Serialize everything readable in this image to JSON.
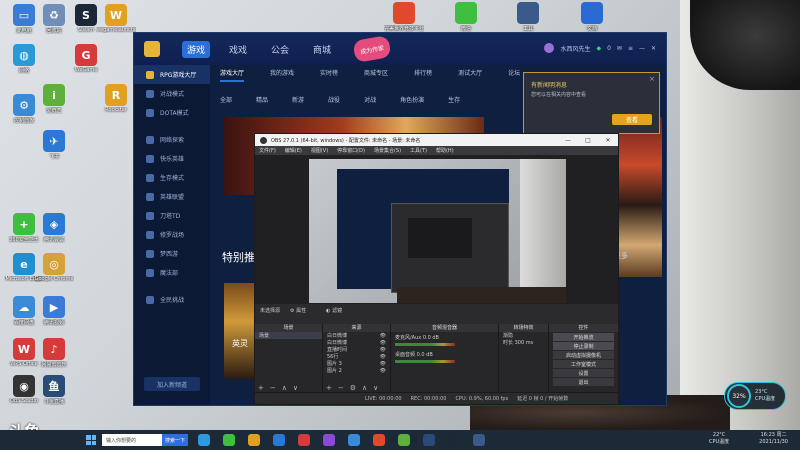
{
  "desktop": {
    "icons": [
      {
        "label": "此电脑",
        "color": "#3a7bd5",
        "glyph": "▭"
      },
      {
        "label": "回收站",
        "color": "#6f8fb8",
        "glyph": "♻"
      },
      {
        "label": "控制面板",
        "color": "#3a8ad5",
        "glyph": "⚙"
      },
      {
        "label": "网络",
        "color": "#2a9ad5",
        "glyph": "◍"
      },
      {
        "label": "360安全卫士",
        "color": "#3fbf3f",
        "glyph": "+"
      },
      {
        "label": "Microsoft Edge",
        "color": "#1f8fcf",
        "glyph": "e"
      },
      {
        "label": "百度网盘",
        "color": "#3a8ad5",
        "glyph": "☁"
      },
      {
        "label": "WPS Office",
        "color": "#d63a3a",
        "glyph": "W"
      },
      {
        "label": "OBS Studio",
        "color": "#333333",
        "glyph": "◉"
      },
      {
        "label": "腾讯视频",
        "color": "#3a7bd5",
        "glyph": "▶"
      },
      {
        "label": "斗鱼直播",
        "color": "#2a4a7a",
        "glyph": "鱼"
      },
      {
        "label": "爱奇艺",
        "color": "#5fb03a",
        "glyph": "i"
      },
      {
        "label": "飞书",
        "color": "#2a7ad5",
        "glyph": "✈"
      },
      {
        "label": "网易云音乐",
        "color": "#d63a3a",
        "glyph": "♪"
      },
      {
        "label": "Google Chrome",
        "color": "#d6a03a",
        "glyph": "◎"
      },
      {
        "label": "腾讯会议",
        "color": "#2a7ad5",
        "glyph": "◈"
      },
      {
        "label": "Steam",
        "color": "#1b2838",
        "glyph": "S"
      },
      {
        "label": "wegamelauncher",
        "color": "#e0a020",
        "glyph": "W"
      },
      {
        "label": "WeGame",
        "color": "#d63a3a",
        "glyph": "G"
      },
      {
        "label": "Rockstar",
        "color": "#e0a020",
        "glyph": "R"
      }
    ],
    "top_icons": [
      {
        "label": "完美世界竞技平台",
        "color": "#e04a2a"
      },
      {
        "label": "微信",
        "color": "#3fbf3f"
      },
      {
        "label": "工具",
        "color": "#3a5a8a"
      },
      {
        "label": "文档",
        "color": "#2a6ad5"
      }
    ]
  },
  "launcher": {
    "nav": [
      "游戏",
      "戏戏",
      "公会",
      "商城"
    ],
    "active_nav": "游戏",
    "badge": "成为作家",
    "user_name": "水西风先生",
    "gem_count": "0",
    "sidebar": [
      "RPG游戏大厅",
      "对战模式",
      "DOTA模式",
      "网络探索",
      "快乐英雄",
      "生存模式",
      "英雄联盟",
      "刀塔TD",
      "修罗战场",
      "梦西游",
      "魔法部",
      "全民挑战"
    ],
    "sidebar_active": "RPG游戏大厅",
    "join_button": "加入新频道",
    "tabs": [
      "游戏大厅",
      "我的游戏",
      "实时榜",
      "商城专区",
      "排行榜",
      "测试大厅",
      "论坛"
    ],
    "active_tab": "游戏大厅",
    "subtabs": [
      "全部",
      "精品",
      "新游",
      "战役",
      "对战",
      "角色扮演",
      "生存"
    ],
    "section_title": "特别推荐",
    "section_more": "更多",
    "card_title": "英灵"
  },
  "popup": {
    "title": "有新闻明消息",
    "desc": "您可以在相关内容中查看",
    "button": "查看",
    "close": "×"
  },
  "obs": {
    "title": "OBS 27.0.1 (64-bit, windows) - 配置文件: 未命名 - 场景: 未命名",
    "menu": [
      "文件(F)",
      "编辑(E)",
      "视图(V)",
      "停靠窗口(D)",
      "场景集合(S)",
      "工具(T)",
      "帮助(H)"
    ],
    "source_label": "未选择源",
    "source_props": "属性",
    "source_filters": "滤镜",
    "docks": {
      "scenes": {
        "title": "场景",
        "items": [
          "场景"
        ]
      },
      "sources": {
        "title": "来源",
        "items": [
          "白日微博",
          "白日微博",
          "直播时间",
          "56行",
          "图片 3",
          "图片 2"
        ]
      },
      "mixer": {
        "title": "音频混音器",
        "items": [
          {
            "name": "麦克风/Aux",
            "db": "0.0 dB"
          },
          {
            "name": "桌面音频",
            "db": "0.0 dB"
          }
        ]
      },
      "transitions": {
        "title": "转场特效",
        "type": "渐隐",
        "duration_label": "时长",
        "duration": "300 ms"
      },
      "controls": {
        "title": "控件",
        "buttons": [
          "开始推流",
          "停止录制",
          "启动虚拟摄像机",
          "工作室模式",
          "设置",
          "退出"
        ]
      }
    },
    "status": {
      "live": "LIVE: 00:00:00",
      "rec": "REC: 00:00:00",
      "cpu": "CPU: 0.9%, 60.00 fps",
      "extra": "延迟 0 帧 0 / 开始帧数"
    }
  },
  "taskbar": {
    "logo": "斗鱼",
    "search_placeholder": "输入你想要的",
    "search_button": "搜索一下",
    "app_colors": [
      "#2f9ae0",
      "#3fbf3f",
      "#e0a020",
      "#2a7ad5",
      "#d63a3a",
      "#8a4ad5",
      "#3a8ad5",
      "#e04a2a",
      "#5fb03a",
      "#2a4a7a",
      "#1b2838",
      "#3a5a8a"
    ],
    "weather_temp": "22°C",
    "weather_desc": "CPU温度",
    "time": "16:23 周二",
    "date": "2021/11/30"
  },
  "cpu_widget": {
    "percent": "32%",
    "temp": "23°C",
    "label": "CPU温度"
  }
}
